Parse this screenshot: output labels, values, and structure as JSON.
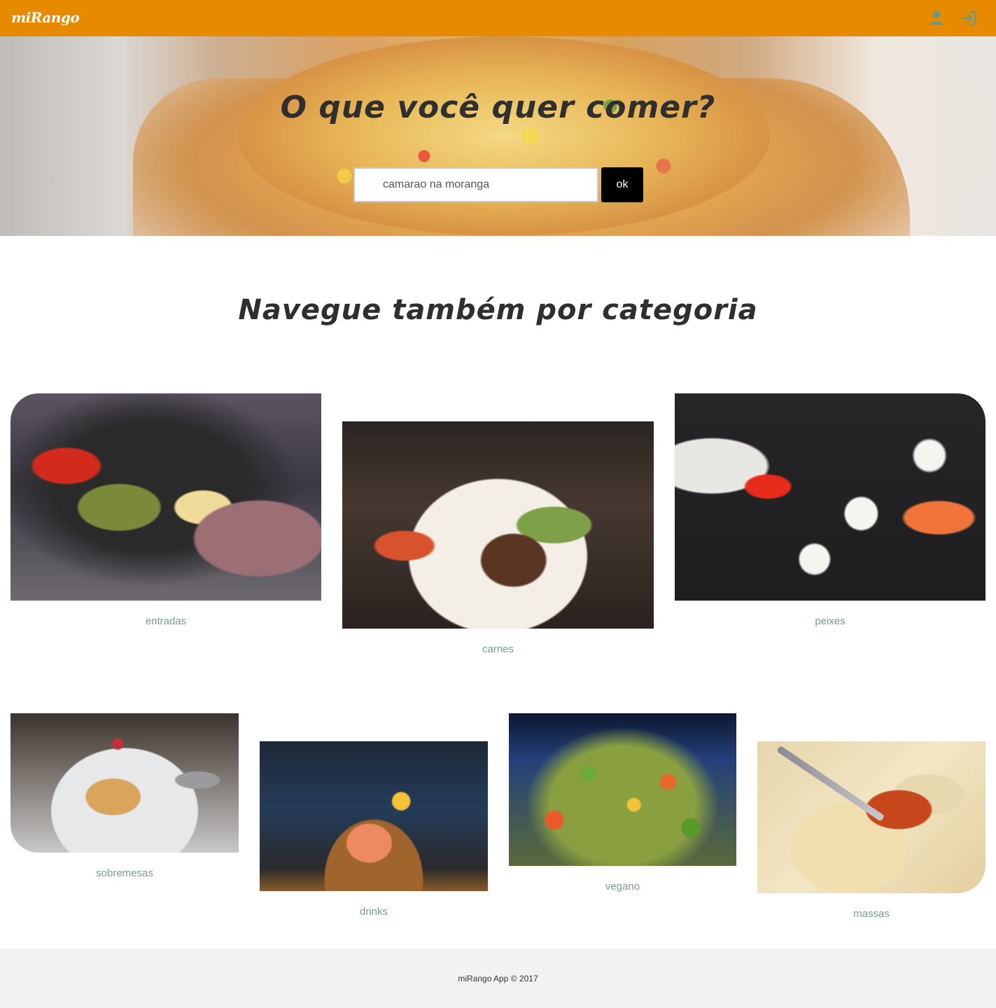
{
  "navbar": {
    "brand": "miRango",
    "icons": [
      "user-icon",
      "login-icon"
    ],
    "color": "#e88a00",
    "icon_color": "#5d9b9b"
  },
  "hero": {
    "title": "O que você quer comer?",
    "search": {
      "value": "camarao na moranga",
      "placeholder": ""
    },
    "button_label": "ok"
  },
  "categories_section": {
    "title": "Navegue também por categoria",
    "items": [
      {
        "label": "entradas"
      },
      {
        "label": "carnes"
      },
      {
        "label": "peixes"
      },
      {
        "label": "sobremesas"
      },
      {
        "label": "drinks"
      },
      {
        "label": "vegano"
      },
      {
        "label": "massas"
      }
    ]
  },
  "footer": {
    "text": "miRango App © 2017"
  }
}
